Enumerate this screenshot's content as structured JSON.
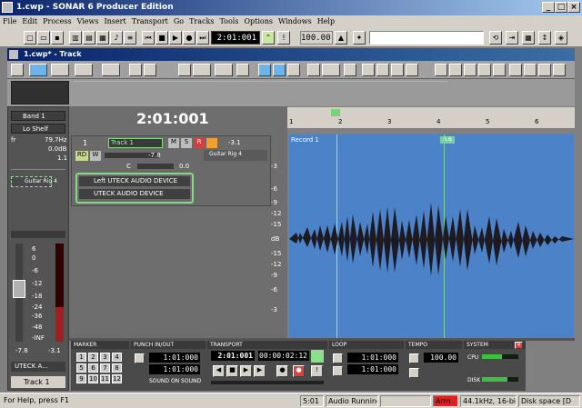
{
  "window": {
    "title": "1.cwp - SONAR 6 Producer Edition"
  },
  "menu": [
    "File",
    "Edit",
    "Process",
    "Views",
    "Insert",
    "Transport",
    "Go",
    "Tracks",
    "Tools",
    "Options",
    "Windows",
    "Help"
  ],
  "toolbar": {
    "time": "2:01:001",
    "tempo": "100.00"
  },
  "doc": {
    "title": "1.cwp* - Track"
  },
  "inspector": {
    "eq_band": "Band 1",
    "eq_type": "Lo Shelf",
    "freq_label": "fr",
    "freq_value": "79.7Hz",
    "gain_value": "0.0dB",
    "q_value": "1.1",
    "fx_slot": "Guitar Rig 4",
    "fader_left": "-7.8",
    "fader_right": "-3.1",
    "input_label": "UTECK A...",
    "track_name": "Track 1",
    "scale": [
      "6",
      "0",
      "-6",
      "-12",
      "-18",
      "-24",
      "-36",
      "-48",
      "-INF"
    ]
  },
  "track": {
    "now_time": "2:01:001",
    "number": "1",
    "name": "Track 1",
    "btn_m": "M",
    "btn_s": "S",
    "btn_r": "R",
    "phase": "-3.1",
    "btn_rd": "RD",
    "btn_w": "W",
    "vol": "-7.8",
    "pan_label": "C",
    "pan_value": "0.0",
    "input": "Left UTECK AUDIO DEVICE",
    "output": "UTECK AUDIO DEVICE",
    "fx_bin_title": "Guitar Rig 4",
    "db_scale": [
      "-3",
      "-6",
      "-9",
      "-12",
      "-15",
      "dB",
      "-15",
      "-12",
      "-9",
      "-6",
      "-3"
    ]
  },
  "ruler": {
    "marks": [
      "1",
      "2",
      "3",
      "4",
      "5",
      "6"
    ],
    "marker_label": "6.6"
  },
  "clip": {
    "name": "Record 1"
  },
  "transport": {
    "marker_label": "MARKER",
    "punch_label": "PUNCH IN/OUT",
    "transport_label": "TRANSPORT",
    "loop_label": "LOOP",
    "tempo_label": "TEMPO",
    "system_label": "SYSTEM",
    "keypad": [
      "1",
      "2",
      "3",
      "4",
      "5",
      "6",
      "7",
      "8",
      "9",
      "10",
      "11",
      "12"
    ],
    "punch_in": "1:01:000",
    "punch_out": "1:01:000",
    "punch_mode": "SOUND ON SOUND",
    "now_mbt": "2:01:001",
    "now_smpte": "00:00:02:12",
    "loop_in": "1:01:000",
    "loop_out": "1:01:000",
    "tempo": "100.00",
    "cpu_label": "CPU",
    "disk_label": "DISK"
  },
  "status": {
    "help": "For Help, press F1",
    "position": "5:01",
    "audio": "Audio Running",
    "arm": "Arm",
    "format": "44.1kHz, 16-bit",
    "disk": "Disk space [D"
  },
  "colors": {
    "waveform": "#4b82c8",
    "accent": "#78d0a0"
  }
}
